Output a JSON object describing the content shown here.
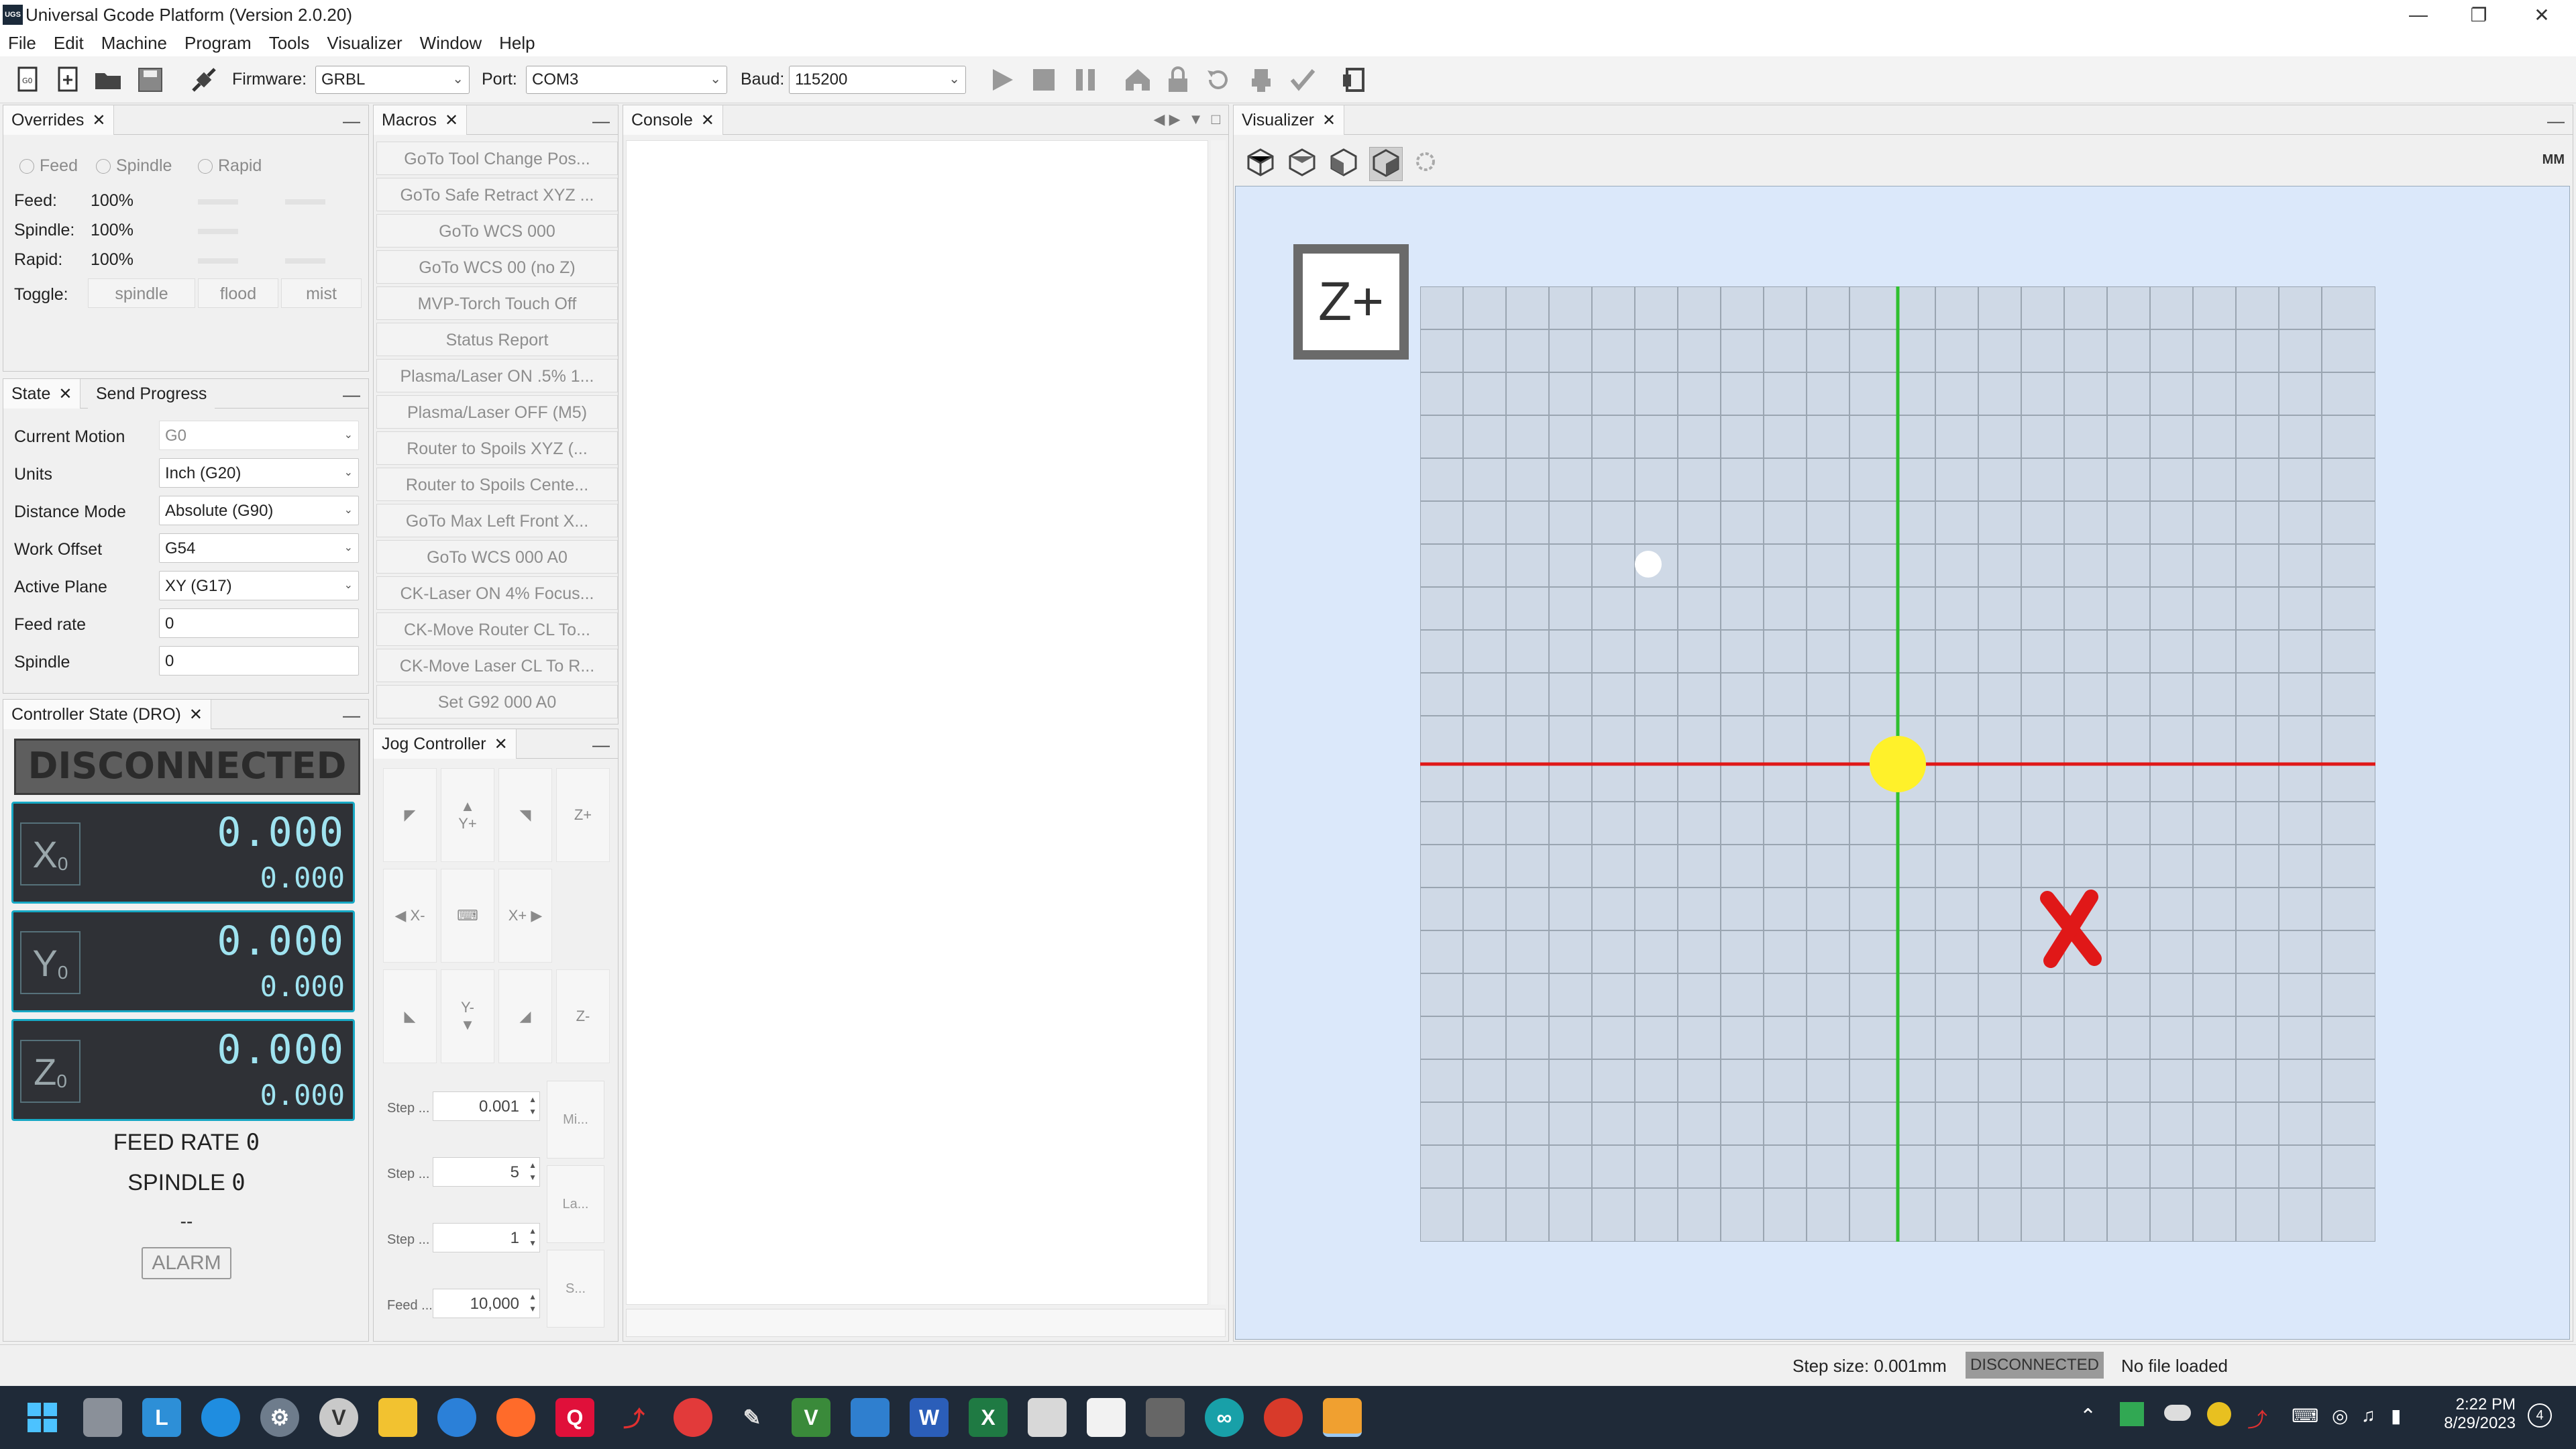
{
  "window": {
    "title": "Universal Gcode Platform (Version 2.0.20)",
    "app_icon": "UGS",
    "controls": [
      "minimize",
      "maximize",
      "close"
    ]
  },
  "menu": [
    "File",
    "Edit",
    "Machine",
    "Program",
    "Tools",
    "Visualizer",
    "Window",
    "Help"
  ],
  "toolbar": {
    "firmware_label": "Firmware:",
    "firmware_value": "GRBL",
    "port_label": "Port:",
    "port_value": "COM3",
    "baud_label": "Baud:",
    "baud_value": "115200"
  },
  "overrides": {
    "tab": "Overrides",
    "radios": [
      "Feed",
      "Spindle",
      "Rapid"
    ],
    "rows": [
      {
        "label": "Feed:",
        "value": "100%"
      },
      {
        "label": "Spindle:",
        "value": "100%"
      },
      {
        "label": "Rapid:",
        "value": "100%"
      }
    ],
    "toggle_label": "Toggle:",
    "toggles": [
      "spindle",
      "flood",
      "mist"
    ]
  },
  "state": {
    "tab": "State",
    "tab2": "Send Progress",
    "rows": [
      {
        "label": "Current Motion",
        "value": "G0"
      },
      {
        "label": "Units",
        "value": "Inch (G20)"
      },
      {
        "label": "Distance Mode",
        "value": "Absolute (G90)"
      },
      {
        "label": "Work Offset",
        "value": "G54"
      },
      {
        "label": "Active Plane",
        "value": "XY (G17)"
      },
      {
        "label": "Feed rate",
        "value": "0"
      },
      {
        "label": "Spindle",
        "value": "0"
      }
    ]
  },
  "dro": {
    "tab": "Controller State (DRO)",
    "status": "DISCONNECTED",
    "axes": [
      {
        "name": "X",
        "sub": "0",
        "work": "0.000",
        "machine": "0.000"
      },
      {
        "name": "Y",
        "sub": "0",
        "work": "0.000",
        "machine": "0.000"
      },
      {
        "name": "Z",
        "sub": "0",
        "work": "0.000",
        "machine": "0.000"
      }
    ],
    "feed_label": "FEED RATE",
    "feed_value": "0",
    "spindle_label": "SPINDLE",
    "spindle_value": "0",
    "dashes": "--",
    "alarm": "ALARM"
  },
  "macros": {
    "tab": "Macros",
    "items": [
      "GoTo Tool Change Pos...",
      "GoTo Safe Retract XYZ ...",
      "GoTo WCS 000",
      "GoTo WCS 00 (no Z)",
      "MVP-Torch Touch Off",
      "Status Report",
      "Plasma/Laser ON .5% 1...",
      "Plasma/Laser OFF (M5)",
      "Router to Spoils XYZ  (...",
      "Router to Spoils Cente...",
      "GoTo Max Left Front X...",
      "GoTo WCS 000 A0",
      "CK-Laser ON 4% Focus...",
      "CK-Move Router CL To...",
      "CK-Move Laser CL To R...",
      "Set G92 000 A0"
    ]
  },
  "jog": {
    "tab": "Jog Controller",
    "buttons": {
      "yplus": "Y+",
      "yminus": "Y-",
      "xminus": "X-",
      "xplus": "X+",
      "zplus": "Z+",
      "zminus": "Z-"
    },
    "steps": [
      {
        "label": "Step ...",
        "value": "0.001"
      },
      {
        "label": "Step ...",
        "value": "5"
      },
      {
        "label": "Step ...",
        "value": "1"
      },
      {
        "label": "Feed ...",
        "value": "10,000"
      }
    ],
    "side": [
      "Mi...",
      "La...",
      "S..."
    ]
  },
  "console": {
    "tab": "Console"
  },
  "visualizer": {
    "tab": "Visualizer",
    "units": "MM",
    "view_label": "Z+"
  },
  "status": {
    "step_size": "Step size: 0.001mm",
    "connection": "DISCONNECTED",
    "file": "No file loaded"
  },
  "taskbar": {
    "time": "2:22 PM",
    "date": "8/29/2023",
    "notifications": "4"
  }
}
